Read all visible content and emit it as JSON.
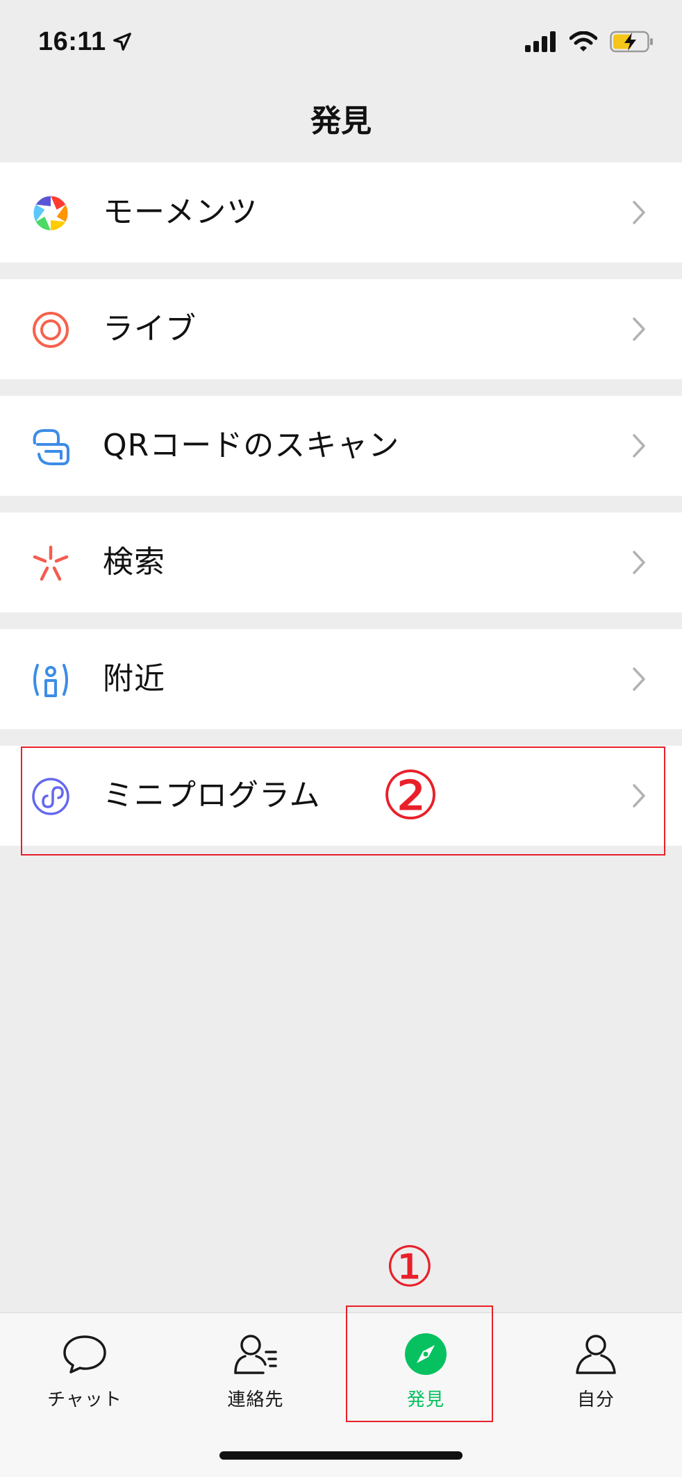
{
  "status_bar": {
    "time": "16:11"
  },
  "nav": {
    "title": "発見"
  },
  "menu": [
    {
      "label": "モーメンツ",
      "icon": "moments-icon"
    },
    {
      "label": "ライブ",
      "icon": "live-icon"
    },
    {
      "label": "QRコードのスキャン",
      "icon": "scan-icon"
    },
    {
      "label": "検索",
      "icon": "search-icon"
    },
    {
      "label": "附近",
      "icon": "nearby-icon"
    },
    {
      "label": "ミニプログラム",
      "icon": "mini-program-icon"
    }
  ],
  "annotations": {
    "step1": "①",
    "step2": "②",
    "color": "#e8202a"
  },
  "tabs": [
    {
      "label": "チャット",
      "icon": "chat-icon"
    },
    {
      "label": "連絡先",
      "icon": "contacts-icon"
    },
    {
      "label": "発見",
      "icon": "discover-icon",
      "active": true
    },
    {
      "label": "自分",
      "icon": "me-icon"
    }
  ],
  "colors": {
    "accent_green": "#07c160",
    "background": "#ededed",
    "annotation_red": "#e8202a"
  }
}
